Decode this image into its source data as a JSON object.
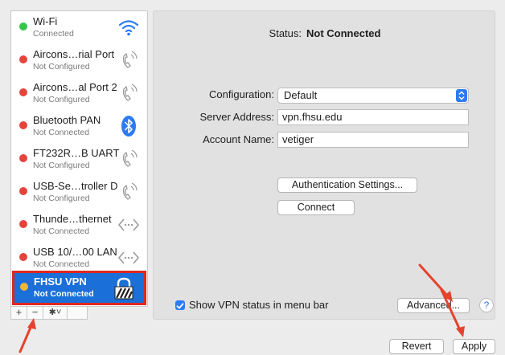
{
  "sidebar": {
    "services": [
      {
        "name": "Wi-Fi",
        "status": "Connected",
        "dot": "#34c749",
        "icon": "wifi-icon"
      },
      {
        "name": "Aircons…rial Port",
        "status": "Not Configured",
        "dot": "#e5433b",
        "icon": "phone-icon"
      },
      {
        "name": "Aircons…al Port 2",
        "status": "Not Configured",
        "dot": "#e5433b",
        "icon": "phone-icon"
      },
      {
        "name": "Bluetooth PAN",
        "status": "Not Connected",
        "dot": "#e5433b",
        "icon": "bluetooth-icon"
      },
      {
        "name": "FT232R…B UART",
        "status": "Not Configured",
        "dot": "#e5433b",
        "icon": "phone-icon"
      },
      {
        "name": "USB-Se…troller D",
        "status": "Not Configured",
        "dot": "#e5433b",
        "icon": "phone-icon"
      },
      {
        "name": "Thunde…thernet",
        "status": "Not Connected",
        "dot": "#e5433b",
        "icon": "ethernet-icon"
      },
      {
        "name": "USB 10/…00 LAN",
        "status": "Not Connected",
        "dot": "#e5433b",
        "icon": "ethernet-icon"
      },
      {
        "name": "FHSU VPN",
        "status": "Not Connected",
        "dot": "#f5b731",
        "icon": "vpn-lock-icon",
        "selected": true
      }
    ],
    "controls": {
      "add": "+",
      "remove": "−",
      "action": "✱˅"
    }
  },
  "panel": {
    "status_label": "Status:",
    "status_value": "Not Connected",
    "configuration_label": "Configuration:",
    "configuration_value": "Default",
    "server_label": "Server Address:",
    "server_value": "vpn.fhsu.edu",
    "account_label": "Account Name:",
    "account_value": "vetiger",
    "auth_button": "Authentication Settings...",
    "connect_button": "Connect",
    "show_status_label": "Show VPN status in menu bar",
    "show_status_checked": true,
    "advanced_button": "Advanced...",
    "help": "?"
  },
  "footer": {
    "revert_button": "Revert",
    "apply_button": "Apply"
  },
  "colors": {
    "accent": "#1a6fd8",
    "highlight": "#e0271f",
    "checkbox": "#2d7bf3"
  }
}
